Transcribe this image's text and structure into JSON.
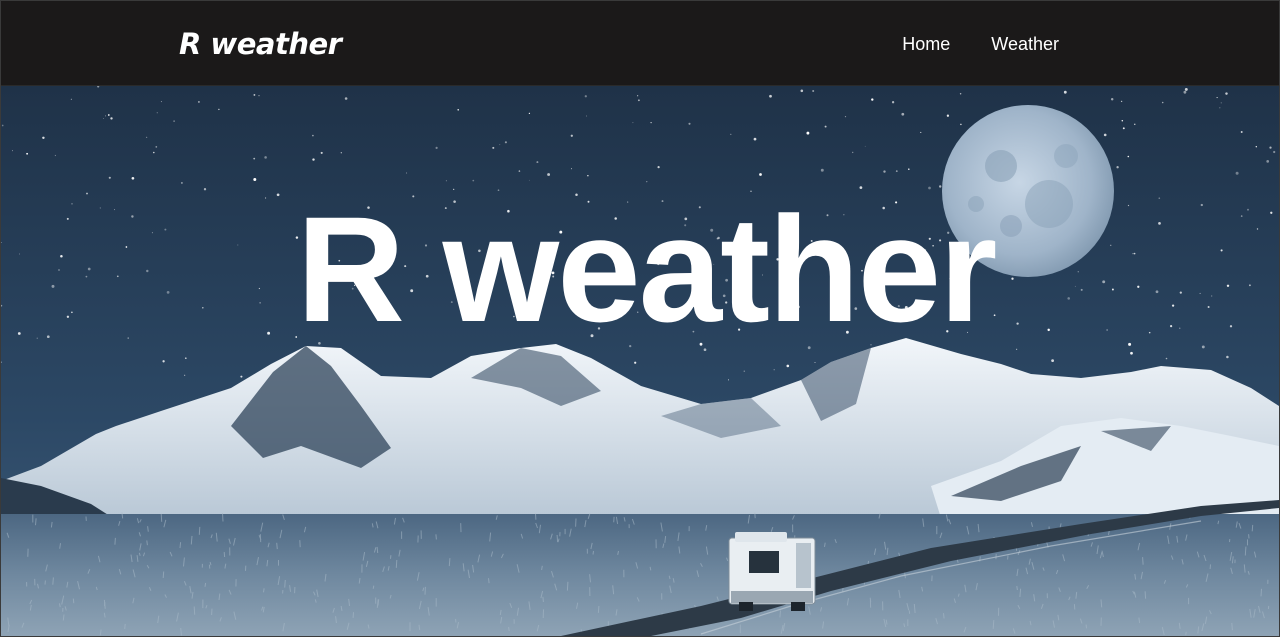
{
  "nav": {
    "brand": "R weather",
    "links": [
      {
        "label": "Home"
      },
      {
        "label": "Weather"
      }
    ]
  },
  "hero": {
    "title": "R weather",
    "image": "night-mountain-road-camper-moon"
  },
  "colors": {
    "navbar_bg": "#1b1919",
    "sky_top": "#22374f",
    "sky_bottom": "#3a5877",
    "snow": "#e6eef5",
    "text": "#ffffff"
  }
}
